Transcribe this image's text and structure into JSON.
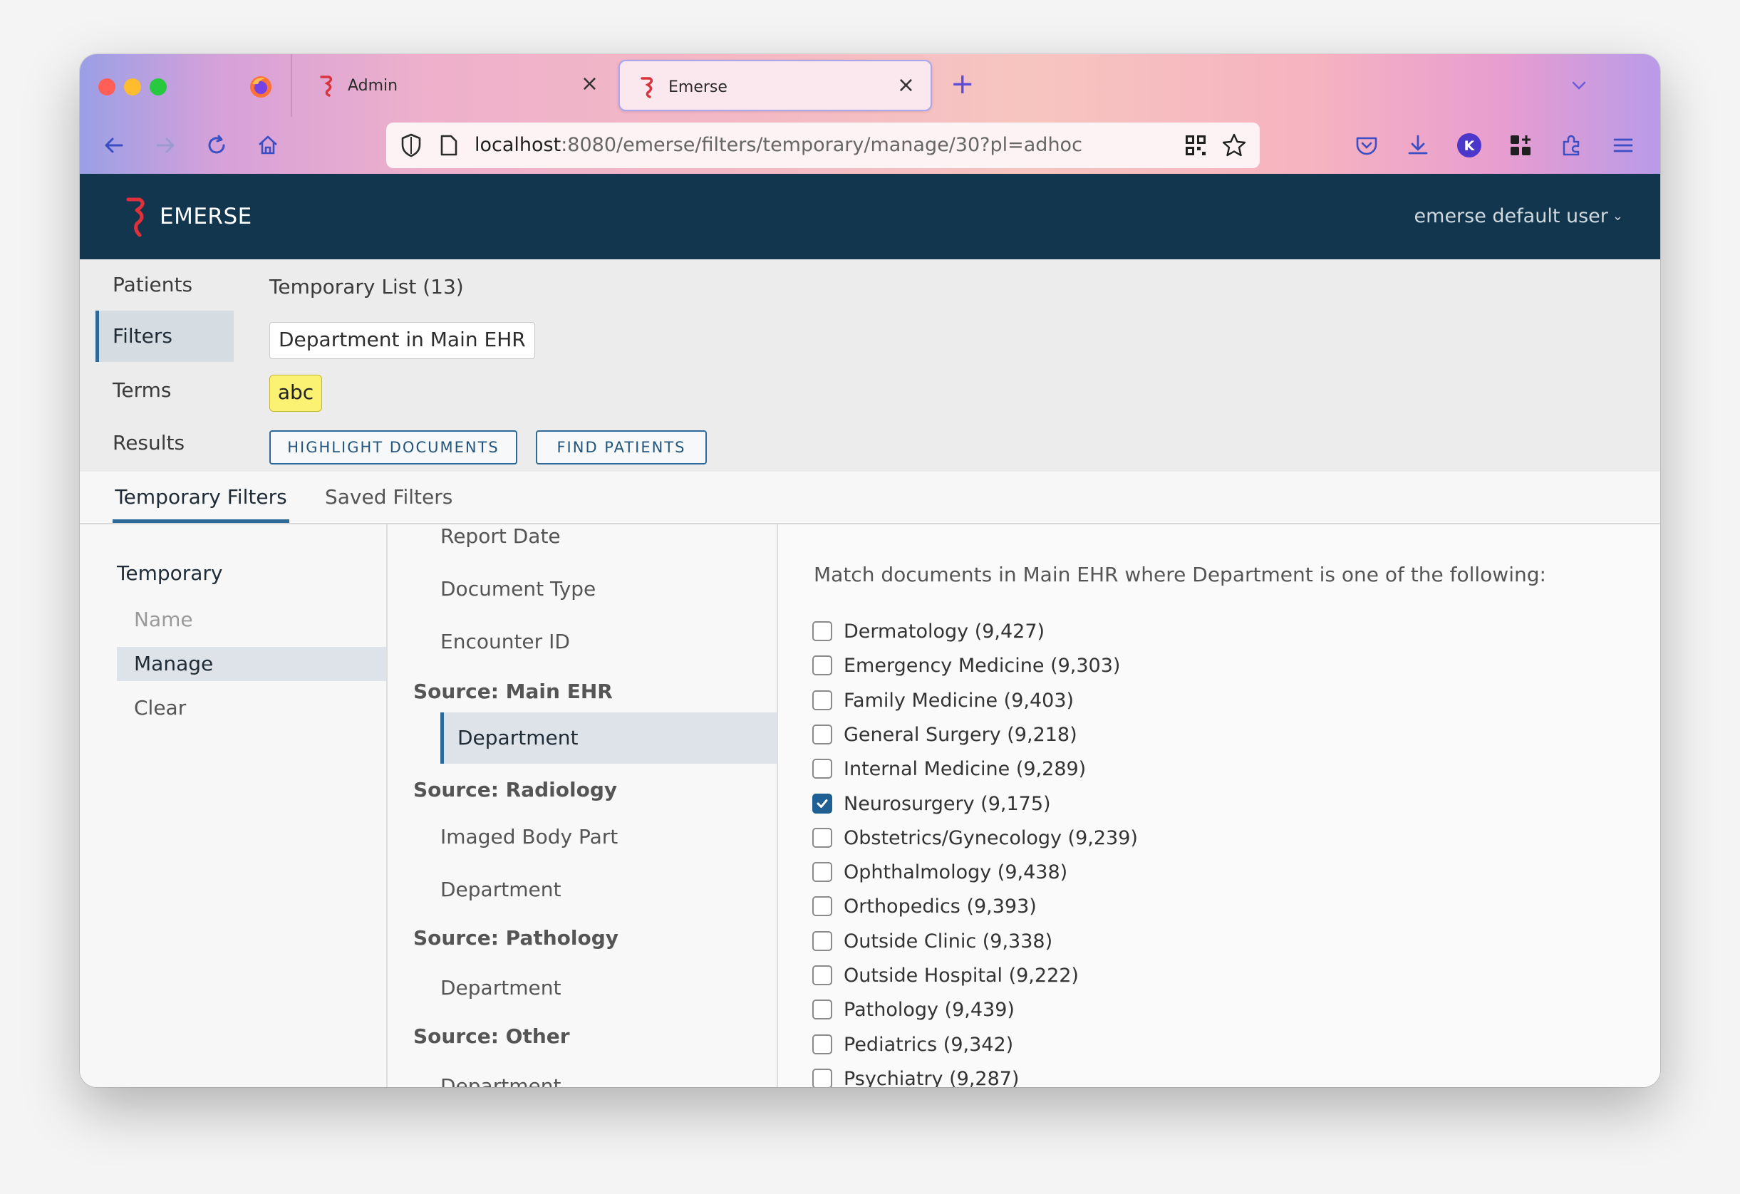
{
  "browser": {
    "tabs": [
      {
        "label": "Admin",
        "active": false
      },
      {
        "label": "Emerse",
        "active": true
      }
    ],
    "url": {
      "host": "localhost",
      "path": ":8080/emerse/filters/temporary/manage/30?pl=adhoc"
    },
    "profile_initial": "K"
  },
  "app": {
    "logo_text": "EMERSE",
    "user_menu": "emerse default user",
    "colors": {
      "header": "#12364e",
      "accent": "#2d6a99",
      "logo": "#e0303a",
      "term_highlight": "#fbf273"
    }
  },
  "summary": {
    "nav": [
      {
        "label": "Patients",
        "active": false
      },
      {
        "label": "Filters",
        "active": true
      },
      {
        "label": "Terms",
        "active": false
      },
      {
        "label": "Results",
        "active": false
      }
    ],
    "patients_value": "Temporary List (13)",
    "filter_chip": "Department in Main EHR",
    "term_chip": "abc",
    "buttons": {
      "highlight": "HIGHLIGHT DOCUMENTS",
      "find": "FIND PATIENTS"
    }
  },
  "filter_tabs": [
    {
      "label": "Temporary Filters",
      "active": true
    },
    {
      "label": "Saved Filters",
      "active": false
    }
  ],
  "left_menu": {
    "heading": "Temporary",
    "items": [
      {
        "label": "Name",
        "state": "disabled"
      },
      {
        "label": "Manage",
        "state": "active"
      },
      {
        "label": "Clear",
        "state": "normal"
      }
    ]
  },
  "field_menu": {
    "top_items": [
      "Report Date",
      "Document Type",
      "Encounter ID"
    ],
    "sections": [
      {
        "title": "Source: Main EHR",
        "items": [
          "Department"
        ]
      },
      {
        "title": "Source: Radiology",
        "items": [
          "Imaged Body Part",
          "Department"
        ]
      },
      {
        "title": "Source: Pathology",
        "items": [
          "Department"
        ]
      },
      {
        "title": "Source: Other",
        "items": [
          "Department"
        ]
      }
    ],
    "active": "Source: Main EHR / Department"
  },
  "filter_panel": {
    "description": "Match documents in Main EHR where Department is one of the following:",
    "options": [
      {
        "label": "Dermatology (9,427)",
        "checked": false
      },
      {
        "label": "Emergency Medicine (9,303)",
        "checked": false
      },
      {
        "label": "Family Medicine (9,403)",
        "checked": false
      },
      {
        "label": "General Surgery (9,218)",
        "checked": false
      },
      {
        "label": "Internal Medicine (9,289)",
        "checked": false
      },
      {
        "label": "Neurosurgery (9,175)",
        "checked": true
      },
      {
        "label": "Obstetrics/Gynecology (9,239)",
        "checked": false
      },
      {
        "label": "Ophthalmology (9,438)",
        "checked": false
      },
      {
        "label": "Orthopedics (9,393)",
        "checked": false
      },
      {
        "label": "Outside Clinic (9,338)",
        "checked": false
      },
      {
        "label": "Outside Hospital (9,222)",
        "checked": false
      },
      {
        "label": "Pathology (9,439)",
        "checked": false
      },
      {
        "label": "Pediatrics (9,342)",
        "checked": false
      },
      {
        "label": "Psychiatry (9,287)",
        "checked": false
      }
    ]
  }
}
